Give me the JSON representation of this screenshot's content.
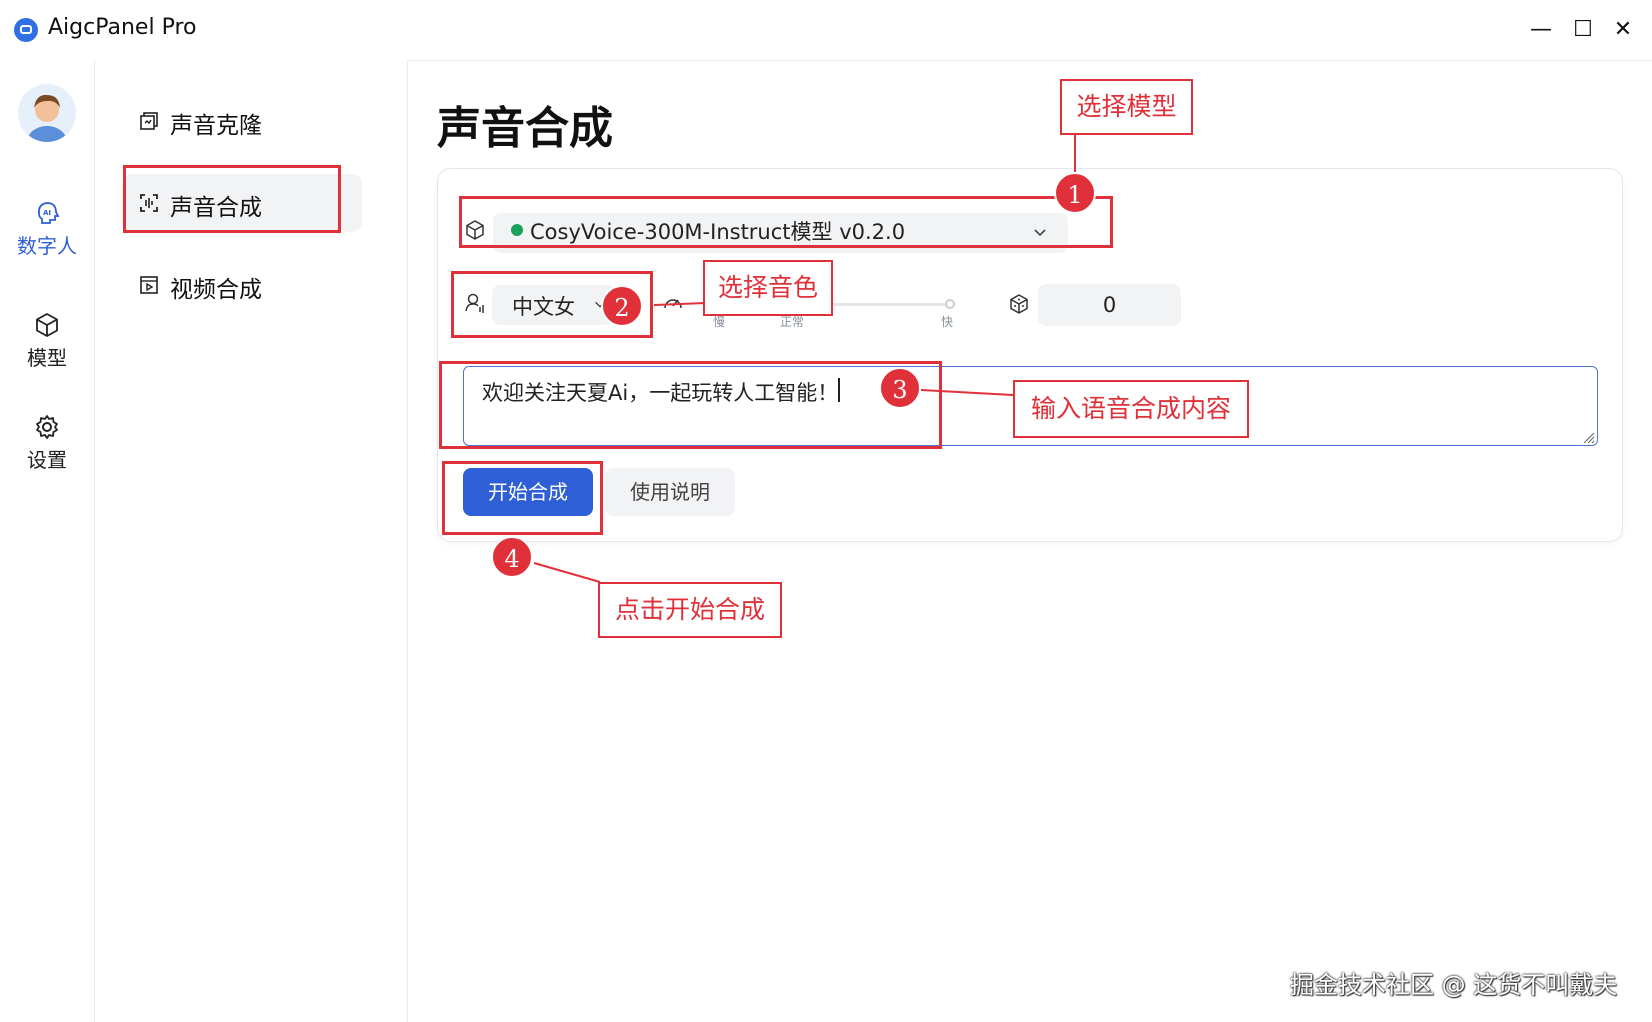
{
  "window": {
    "title": "AigcPanel Pro",
    "minimize": "—",
    "maximize": "☐",
    "close": "✕"
  },
  "rail": {
    "items": [
      {
        "label": "数字人",
        "icon": "ai-head-icon",
        "active": true
      },
      {
        "label": "模型",
        "icon": "cube-icon"
      },
      {
        "label": "设置",
        "icon": "gear-icon"
      }
    ]
  },
  "sidebar": {
    "items": [
      {
        "label": "声音克隆",
        "icon": "voice-clone-icon"
      },
      {
        "label": "声音合成",
        "icon": "scan-voice-icon",
        "active": true
      },
      {
        "label": "视频合成",
        "icon": "video-icon"
      }
    ]
  },
  "main": {
    "title": "声音合成",
    "model": {
      "value": "CosyVoice-300M-Instruct模型 v0.2.0",
      "status_color": "#19a05a"
    },
    "voice": {
      "value": "中文女"
    },
    "speed": {
      "labels": [
        "慢",
        "正常",
        "快"
      ],
      "selected": "正常"
    },
    "seed": {
      "value": "0"
    },
    "text": {
      "value": "欢迎关注天夏Ai，一起玩转人工智能！"
    },
    "buttons": {
      "start": "开始合成",
      "help": "使用说明"
    }
  },
  "annotations": {
    "labels": [
      "选择模型",
      "选择音色",
      "输入语音合成内容",
      "点击开始合成"
    ],
    "badges": [
      "1",
      "2",
      "3",
      "4"
    ],
    "color": "#e0313a"
  },
  "watermark": "掘金技术社区 @ 这货不叫戴夫",
  "colors": {
    "accent": "#2f5fd6"
  }
}
